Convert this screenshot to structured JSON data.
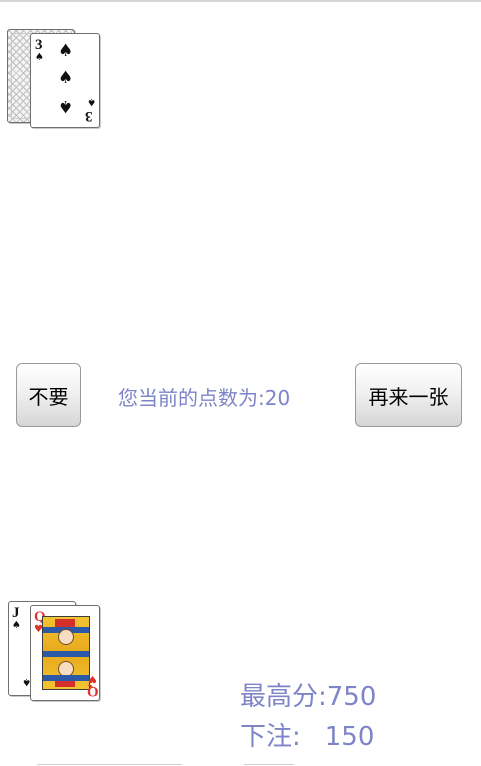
{
  "dealer_hand": {
    "hidden_cards": 1,
    "face_up": [
      {
        "rank": "3",
        "suit": "spades",
        "suit_glyph": "♠",
        "color": "#111111"
      }
    ]
  },
  "controls": {
    "stand_label": "不要",
    "hit_label": "再来一张",
    "points_text": "您当前的点数为:20"
  },
  "player_hand": {
    "cards": [
      {
        "rank": "J",
        "suit": "spades",
        "suit_glyph": "♠",
        "color": "#111111"
      },
      {
        "rank": "Q",
        "suit": "hearts",
        "suit_glyph": "♥",
        "color": "#e0312b"
      }
    ]
  },
  "stats": {
    "high_score_label": "最高分:",
    "high_score_value": "750",
    "bet_label": "下注:",
    "bet_value": "150"
  },
  "colors": {
    "info_text": "#7d84c8",
    "red_suit": "#e0312b",
    "black_suit": "#111111"
  }
}
